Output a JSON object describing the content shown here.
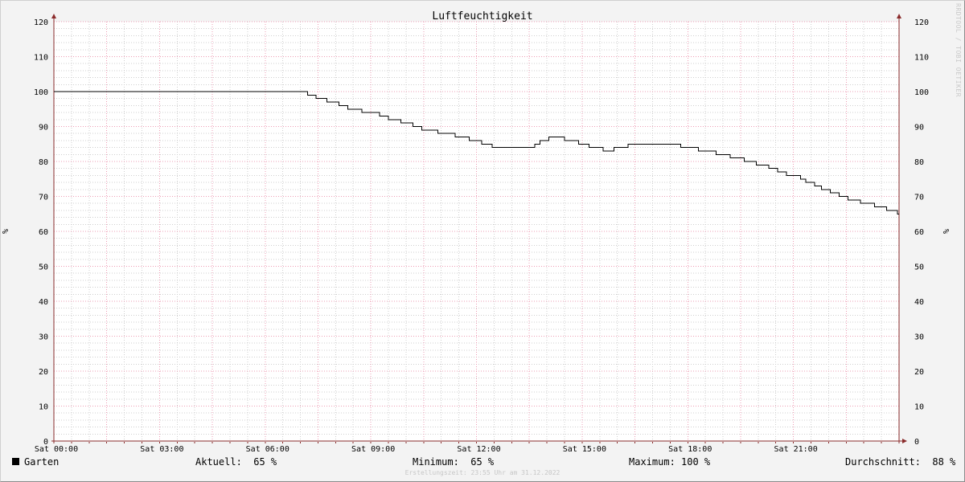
{
  "chart_data": {
    "type": "line",
    "title": "Luftfeuchtigkeit",
    "ylabel": "%",
    "ylim": [
      0,
      120
    ],
    "y_ticks": [
      0,
      10,
      20,
      30,
      40,
      50,
      60,
      70,
      80,
      90,
      100,
      110,
      120
    ],
    "x_tick_labels": [
      "Sat 00:00",
      "Sat 03:00",
      "Sat 06:00",
      "Sat 09:00",
      "Sat 12:00",
      "Sat 15:00",
      "Sat 18:00",
      "Sat 21:00"
    ],
    "x_unit": "hours since Sat 00:00",
    "xlim": [
      0,
      24
    ],
    "grid": true,
    "series": [
      {
        "name": "Garten",
        "color": "#000000",
        "step": true,
        "points": [
          [
            0.0,
            100
          ],
          [
            7.2,
            99
          ],
          [
            7.45,
            98
          ],
          [
            7.75,
            97
          ],
          [
            8.1,
            96
          ],
          [
            8.35,
            95
          ],
          [
            8.75,
            94
          ],
          [
            9.25,
            93
          ],
          [
            9.5,
            92
          ],
          [
            9.85,
            91
          ],
          [
            10.2,
            90
          ],
          [
            10.45,
            89
          ],
          [
            10.9,
            88
          ],
          [
            11.4,
            87
          ],
          [
            11.8,
            86
          ],
          [
            12.15,
            85
          ],
          [
            12.45,
            84
          ],
          [
            13.65,
            85
          ],
          [
            13.8,
            86
          ],
          [
            14.05,
            87
          ],
          [
            14.5,
            86
          ],
          [
            14.9,
            85
          ],
          [
            15.2,
            84
          ],
          [
            15.6,
            83
          ],
          [
            15.9,
            84
          ],
          [
            16.3,
            85
          ],
          [
            17.8,
            84
          ],
          [
            18.3,
            83
          ],
          [
            18.8,
            82
          ],
          [
            19.2,
            81
          ],
          [
            19.6,
            80
          ],
          [
            19.95,
            79
          ],
          [
            20.3,
            78
          ],
          [
            20.55,
            77
          ],
          [
            20.8,
            76
          ],
          [
            21.2,
            75
          ],
          [
            21.35,
            74
          ],
          [
            21.6,
            73
          ],
          [
            21.8,
            72
          ],
          [
            22.05,
            71
          ],
          [
            22.3,
            70
          ],
          [
            22.55,
            69
          ],
          [
            22.9,
            68
          ],
          [
            23.3,
            67
          ],
          [
            23.65,
            66
          ],
          [
            23.95,
            65
          ],
          [
            24.0,
            65
          ]
        ]
      }
    ]
  },
  "legend": {
    "series_label": "Garten",
    "current": "Aktuell:  65 %",
    "minimum": "Minimum:  65 %",
    "maximum": "Maximum: 100 %",
    "average": "Durchschnitt:  88 %"
  },
  "footer": "Erstellungszeit: 23:55 Uhr am 31.12.2022",
  "watermark": "RRDTOOL / TOBI OETIKER",
  "colors": {
    "minor_grid": "#cfcfcf",
    "major_grid": "#ee9cb4",
    "axis": "#8a2b2b",
    "line": "#000000"
  }
}
